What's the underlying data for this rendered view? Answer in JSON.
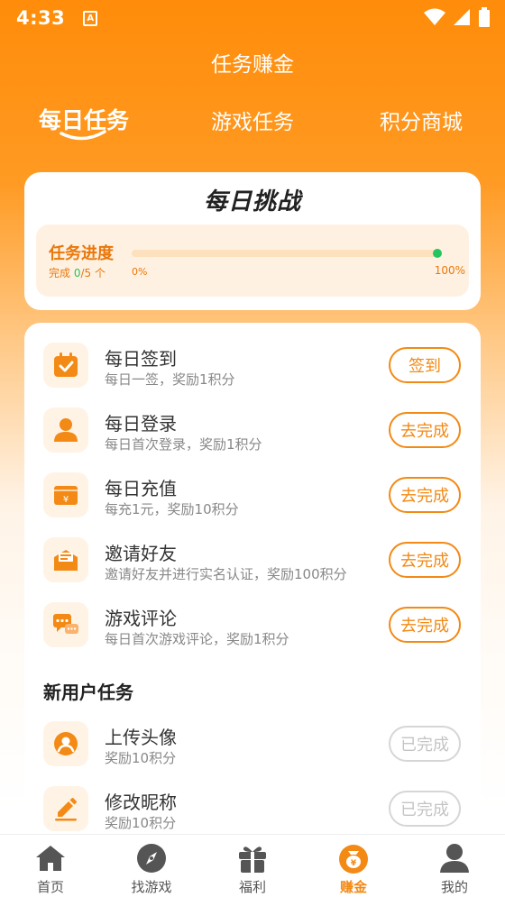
{
  "status_bar": {
    "time": "4:33",
    "notif_glyph": "A"
  },
  "page_title": "任务赚金",
  "tabs": [
    {
      "label": "每日任务",
      "active": true
    },
    {
      "label": "游戏任务",
      "active": false
    },
    {
      "label": "积分商城",
      "active": false
    }
  ],
  "challenge": {
    "title": "每日挑战",
    "progress_label": "任务进度",
    "completed_prefix": "完成 ",
    "completed_count": "0",
    "completed_total": "/5 个",
    "progress_value": 0,
    "min_label": "0%",
    "max_label": "100%"
  },
  "daily_tasks": [
    {
      "name": "每日签到",
      "desc": "每日一签，奖励1积分",
      "button": "签到",
      "icon": "calendar-check-icon"
    },
    {
      "name": "每日登录",
      "desc": "每日首次登录，奖励1积分",
      "button": "去完成",
      "icon": "user-icon"
    },
    {
      "name": "每日充值",
      "desc": "每充1元，奖励10积分",
      "button": "去完成",
      "icon": "wallet-yen-icon"
    },
    {
      "name": "邀请好友",
      "desc": "邀请好友并进行实名认证，奖励100积分",
      "button": "去完成",
      "icon": "envelope-icon"
    },
    {
      "name": "游戏评论",
      "desc": "每日首次游戏评论，奖励1积分",
      "button": "去完成",
      "icon": "comment-icon"
    }
  ],
  "new_user_section": "新用户任务",
  "new_user_tasks": [
    {
      "name": "上传头像",
      "desc": "奖励10积分",
      "button": "已完成",
      "icon": "avatar-upload-icon"
    },
    {
      "name": "修改昵称",
      "desc": "奖励10积分",
      "button": "已完成",
      "icon": "edit-icon"
    }
  ],
  "bottom_nav": [
    {
      "label": "首页",
      "icon": "home-icon",
      "active": false
    },
    {
      "label": "找游戏",
      "icon": "compass-icon",
      "active": false
    },
    {
      "label": "福利",
      "icon": "gift-icon",
      "active": false
    },
    {
      "label": "赚金",
      "icon": "money-bag-icon",
      "active": true
    },
    {
      "label": "我的",
      "icon": "profile-icon",
      "active": false
    }
  ],
  "colors": {
    "accent": "#f28a15",
    "header": "#ff8c0a",
    "success": "#22c55e"
  }
}
